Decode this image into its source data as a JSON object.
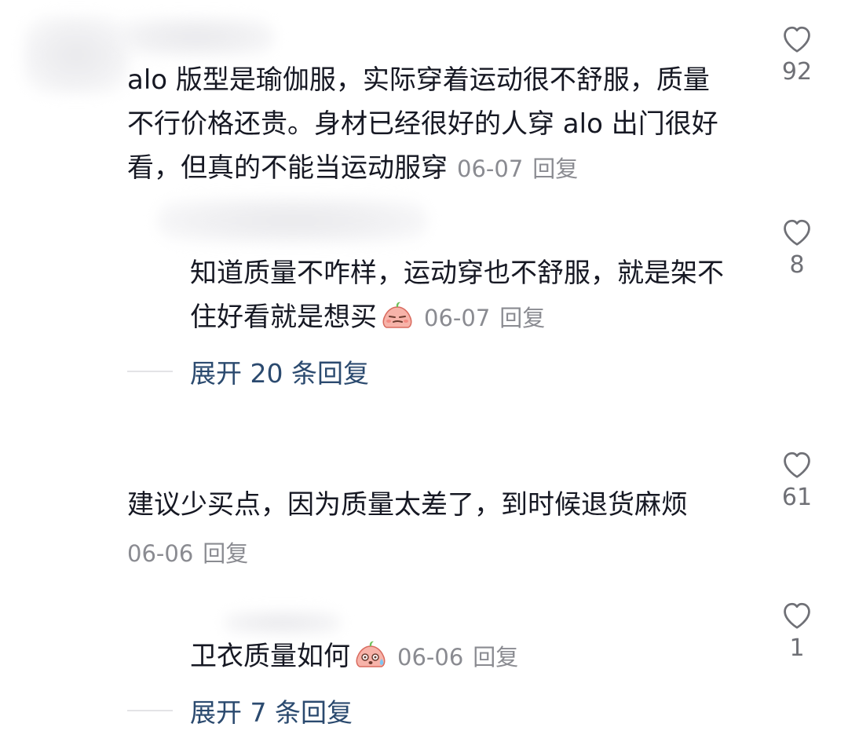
{
  "comments": [
    {
      "text": "alo 版型是瑜伽服，实际穿着运动很不舒服，质量不行价格还贵。身材已经很好的人穿 alo 出门很好看，但真的不能当运动服穿",
      "line1": "alo 版型是瑜伽服，实际穿着运动很不舒服，质量",
      "line2": "不行价格还贵。身材已经很好的人穿 alo 出门很好",
      "line3": "看，但真的不能当运动服穿",
      "date": "06-07",
      "reply_label": "回复",
      "likes": "92"
    },
    {
      "line1": "知道质量不咋样，运动穿也不舒服，就是架不",
      "line2": "住好看就是想买",
      "emoji": "smirk-face-emoji",
      "date": "06-07",
      "reply_label": "回复",
      "likes": "8"
    },
    {
      "text": "建议少买点，因为质量太差了，到时候退货麻烦",
      "date": "06-06",
      "reply_label": "回复",
      "likes": "61"
    },
    {
      "text": "卫衣质量如何",
      "emoji": "sweat-face-emoji",
      "date": "06-06",
      "reply_label": "回复",
      "likes": "1"
    }
  ],
  "expand_replies": [
    {
      "label": "展开 20 条回复"
    },
    {
      "label": "展开 7 条回复"
    }
  ],
  "colors": {
    "text": "#161823",
    "meta": "#8a8b91",
    "expand": "#2b4a6f",
    "heart_outline": "#6f7076"
  }
}
